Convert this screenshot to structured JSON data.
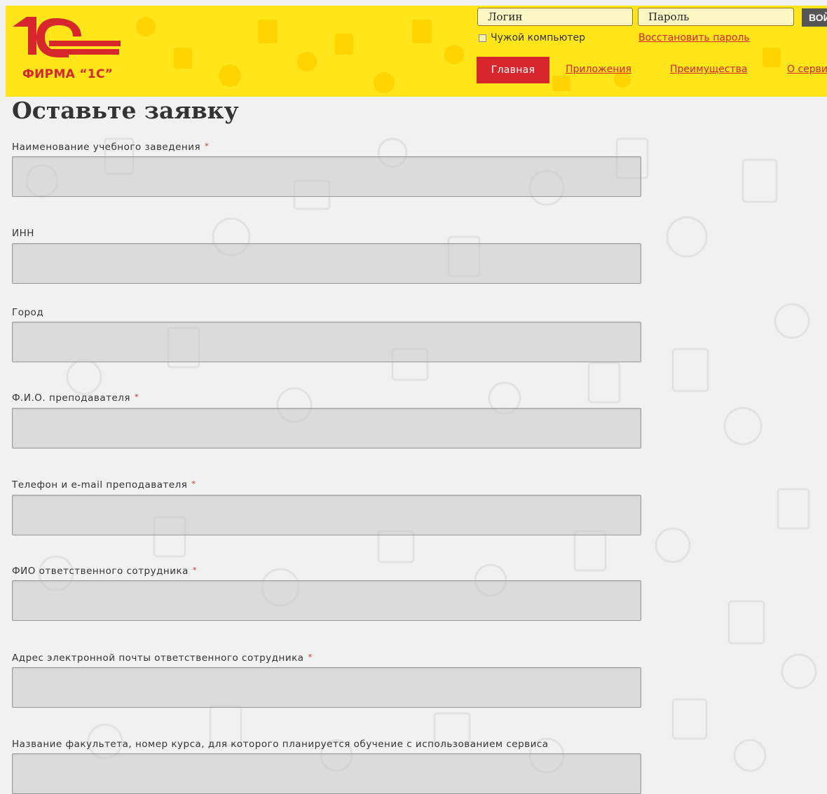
{
  "brand": {
    "logo_text": "ФИРМА “1С”",
    "accent_red": "#d7262c",
    "header_yellow": "#ffe51a"
  },
  "auth": {
    "login_placeholder": "Логин",
    "password_placeholder": "Пароль",
    "login_button": "ВОЙТИ",
    "foreign_pc_label": "Чужой компьютер",
    "restore_password": "Восстановить пароль"
  },
  "nav": {
    "home": "Главная",
    "apps": "Приложения",
    "advantages": "Преимущества",
    "about": "О сервисе"
  },
  "page": {
    "title": "Оставьте заявку"
  },
  "form": {
    "fields": [
      {
        "label": "Наименование учебного заведения",
        "required": "*",
        "value": ""
      },
      {
        "label": "ИНН",
        "required": "",
        "value": ""
      },
      {
        "label": "Город",
        "required": "",
        "value": ""
      },
      {
        "label": "Ф.И.О. преподавателя",
        "required": "*",
        "value": ""
      },
      {
        "label": "Телефон и e-mail преподавателя",
        "required": "*",
        "value": ""
      },
      {
        "label": "ФИО ответственного сотрудника",
        "required": "*",
        "value": ""
      },
      {
        "label": "Адрес электронной почты ответственного сотрудника",
        "required": "*",
        "value": ""
      },
      {
        "label": "Название факультета, номер курса, для которого планируется обучение с использованием сервиса",
        "required": "",
        "value": ""
      }
    ]
  }
}
